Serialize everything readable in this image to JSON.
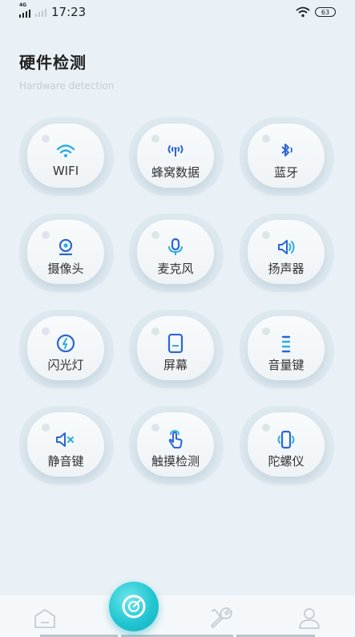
{
  "status_bar": {
    "network": "4G",
    "time": "17:23",
    "battery": "63"
  },
  "header": {
    "title": "硬件检测",
    "subtitle": "Hardware detection"
  },
  "grid": {
    "items": [
      {
        "label": "WIFI",
        "icon": "wifi-icon"
      },
      {
        "label": "蜂窝数据",
        "icon": "cellular-icon"
      },
      {
        "label": "蓝牙",
        "icon": "bluetooth-icon"
      },
      {
        "label": "摄像头",
        "icon": "camera-icon"
      },
      {
        "label": "麦克风",
        "icon": "microphone-icon"
      },
      {
        "label": "扬声器",
        "icon": "speaker-icon"
      },
      {
        "label": "闪光灯",
        "icon": "flash-icon"
      },
      {
        "label": "屏幕",
        "icon": "screen-icon"
      },
      {
        "label": "音量键",
        "icon": "volume-key-icon"
      },
      {
        "label": "静音键",
        "icon": "mute-icon"
      },
      {
        "label": "触摸检测",
        "icon": "touch-icon"
      },
      {
        "label": "陀螺仪",
        "icon": "gyroscope-icon"
      }
    ]
  },
  "tabbar": {
    "tabs": [
      {
        "icon": "home-icon"
      },
      {
        "icon": "scan-icon"
      },
      {
        "icon": "tools-icon"
      },
      {
        "icon": "profile-icon"
      }
    ]
  },
  "colors": {
    "accent": "#22c6d2",
    "icon": "#2aaee0",
    "background": "#e9f1f6"
  }
}
